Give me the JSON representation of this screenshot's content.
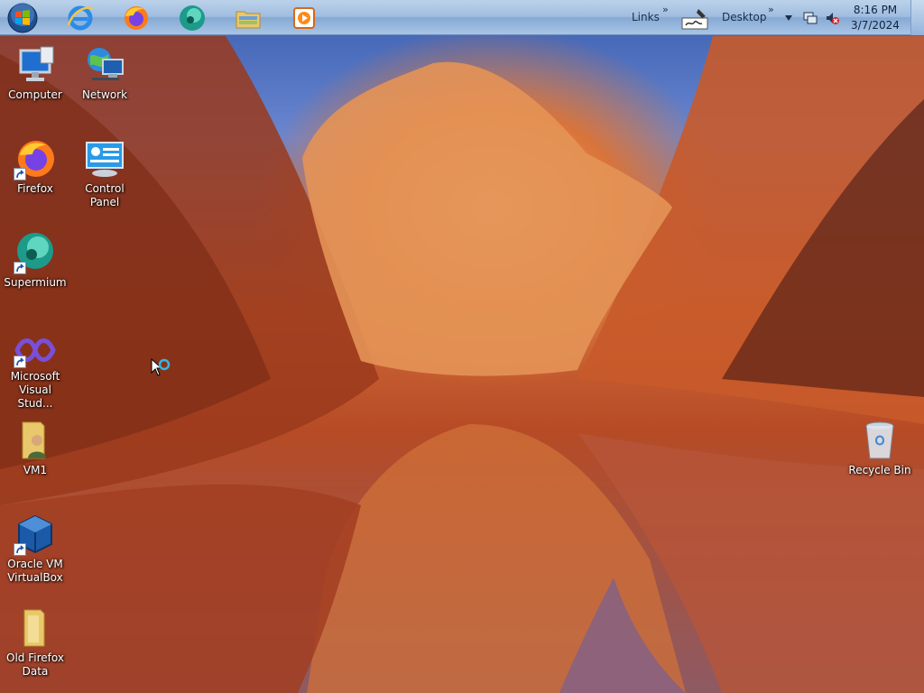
{
  "taskbar": {
    "links_label": "Links",
    "desktop_label": "Desktop",
    "chevron": "»",
    "clock": {
      "time": "8:16 PM",
      "date": "3/7/2024"
    }
  },
  "desktop": {
    "icons": [
      {
        "label": "Computer"
      },
      {
        "label": "Network"
      },
      {
        "label": "Firefox"
      },
      {
        "label": "Control Panel"
      },
      {
        "label": "Supermium"
      },
      {
        "label": "Microsoft Visual Stud..."
      },
      {
        "label": "VM1"
      },
      {
        "label": "Oracle VM VirtualBox"
      },
      {
        "label": "Old Firefox Data"
      },
      {
        "label": "Recycle Bin"
      }
    ]
  },
  "colors": {
    "taskbar_top": "#bcd2ea",
    "taskbar_bottom": "#86a9d3",
    "icon_text": "#ffffff"
  }
}
